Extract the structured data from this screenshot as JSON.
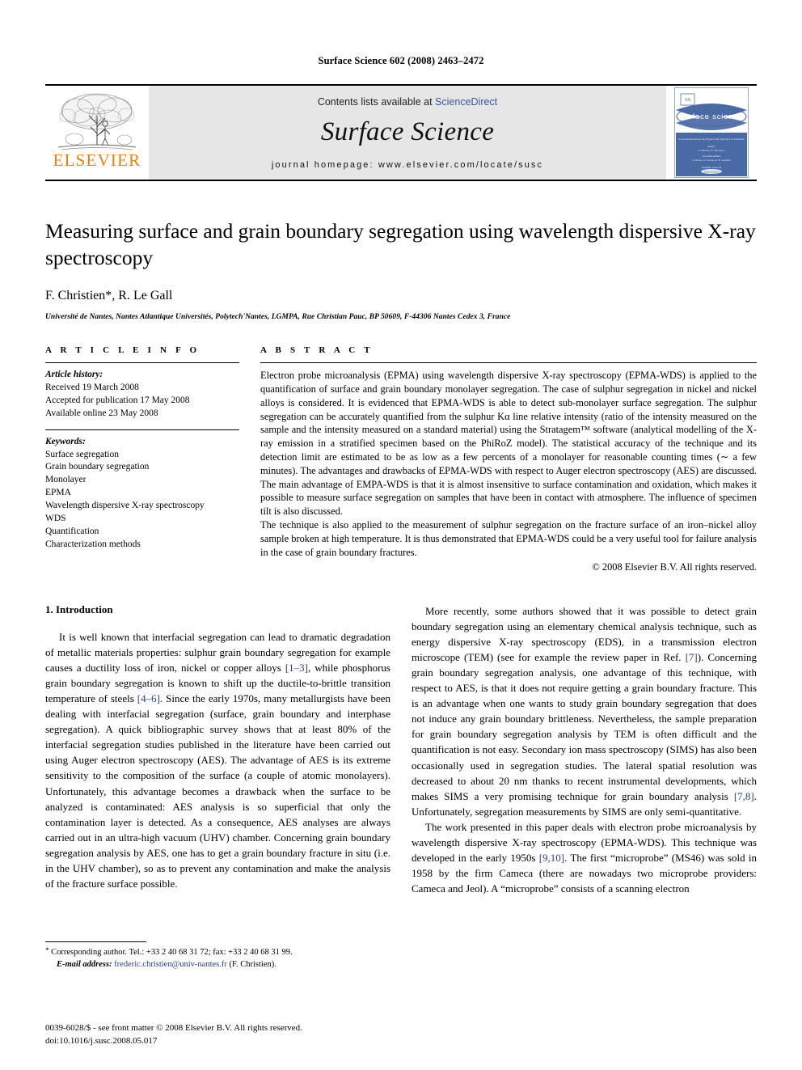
{
  "running_head": "Surface Science 602 (2008) 2463–2472",
  "masthead": {
    "publisher_name": "ELSEVIER",
    "contents_prefix": "Contents lists available at",
    "sciencedirect": "ScienceDirect",
    "journal_title": "Surface Science",
    "homepage": "journal homepage: www.elsevier.com/locate/susc",
    "cover_title": "surface science"
  },
  "article": {
    "title": "Measuring surface and grain boundary segregation using wavelength dispersive X-ray spectroscopy",
    "authors": "F. Christien*, R. Le Gall",
    "affiliation": "Université de Nantes, Nantes Atlantique Universités, Polytech'Nantes, LGMPA, Rue Christian Pauc, BP 50609, F-44306 Nantes Cedex 3, France"
  },
  "article_info": {
    "heading": "A R T I C L E   I N F O",
    "history_label": "Article history:",
    "history": [
      "Received 19 March 2008",
      "Accepted for publication 17 May 2008",
      "Available online 23 May 2008"
    ],
    "keywords_label": "Keywords:",
    "keywords": [
      "Surface segregation",
      "Grain boundary segregation",
      "Monolayer",
      "EPMA",
      "Wavelength dispersive X-ray spectroscopy",
      "WDS",
      "Quantification",
      "Characterization methods"
    ]
  },
  "abstract": {
    "heading": "A B S T R A C T",
    "paragraph1": "Electron probe microanalysis (EPMA) using wavelength dispersive X-ray spectroscopy (EPMA-WDS) is applied to the quantification of surface and grain boundary monolayer segregation. The case of sulphur segregation in nickel and nickel alloys is considered. It is evidenced that EPMA-WDS is able to detect sub-monolayer surface segregation. The sulphur segregation can be accurately quantified from the sulphur Kα line relative intensity (ratio of the intensity measured on the sample and the intensity measured on a standard material) using the Stratagem™ software (analytical modelling of the X-ray emission in a stratified specimen based on the PhiRoZ model). The statistical accuracy of the technique and its detection limit are estimated to be as low as a few percents of a monolayer for reasonable counting times (∼ a few minutes). The advantages and drawbacks of EPMA-WDS with respect to Auger electron spectroscopy (AES) are discussed. The main advantage of EMPA-WDS is that it is almost insensitive to surface contamination and oxidation, which makes it possible to measure surface segregation on samples that have been in contact with atmosphere. The influence of specimen tilt is also discussed.",
    "paragraph2": "The technique is also applied to the measurement of sulphur segregation on the fracture surface of an iron–nickel alloy sample broken at high temperature. It is thus demonstrated that EPMA-WDS could be a very useful tool for failure analysis in the case of grain boundary fractures.",
    "copyright": "© 2008 Elsevier B.V. All rights reserved."
  },
  "introduction": {
    "heading": "1. Introduction",
    "p1_a": "It is well known that interfacial segregation can lead to dramatic degradation of metallic materials properties: sulphur grain boundary segregation for example causes a ductility loss of iron, nickel or copper alloys ",
    "p1_ref1": "[1–3]",
    "p1_b": ", while phosphorus grain boundary segregation is known to shift up the ductile-to-brittle transition temperature of steels ",
    "p1_ref2": "[4–6]",
    "p1_c": ". Since the early 1970s, many metallurgists have been dealing with interfacial segregation (surface, grain boundary and interphase segregation). A quick bibliographic survey shows that at least 80% of the interfacial segregation studies published in the literature have been carried out using Auger electron spectroscopy (AES). The advantage of AES is its extreme sensitivity to the composition of the surface (a couple of atomic monolayers). Unfortunately, this advantage becomes a drawback when the surface to be analyzed is contaminated: AES analysis is so superficial that only the contamination layer is detected. As a consequence, AES analyses are always carried out in an ultra-high vacuum (UHV) chamber. Concerning grain boundary segregation analysis by AES, one has to get a grain boundary fracture in situ (i.e. in the UHV chamber), so as to prevent any contamination and make the analysis of the fracture surface possible.",
    "p2_a": "More recently, some authors showed that it was possible to detect grain boundary segregation using an elementary chemical analysis technique, such as energy dispersive X-ray spectroscopy (EDS), in a transmission electron microscope (TEM) (see for example the review paper in Ref. ",
    "p2_ref1": "[7]",
    "p2_b": "). Concerning grain boundary segregation analysis, one advantage of this technique, with respect to AES, is that it does not require getting a grain boundary fracture. This is an advantage when one wants to study grain boundary segregation that does not induce any grain boundary brittleness. Nevertheless, the sample preparation for grain boundary segregation analysis by TEM is often difficult and the quantification is not easy. Secondary ion mass spectroscopy (SIMS) has also been occasionally used in segregation studies. The lateral spatial resolution was decreased to about 20 nm thanks to recent instrumental developments, which makes SIMS a very promising technique for grain boundary analysis ",
    "p2_ref2": "[7,8]",
    "p2_c": ". Unfortunately, segregation measurements by SIMS are only semi-quantitative.",
    "p3_a": "The work presented in this paper deals with electron probe microanalysis by wavelength dispersive X-ray spectroscopy (EPMA-WDS). This technique was developed in the early 1950s ",
    "p3_ref1": "[9,10]",
    "p3_b": ". The first “microprobe” (MS46) was sold in 1958 by the firm Cameca (there are nowadays two microprobe providers: Cameca and Jeol). A “microprobe” consists of a scanning electron"
  },
  "footnote": {
    "star": "*",
    "corresponding": "Corresponding author. Tel.: +33 2 40 68 31 72; fax: +33 2 40 68 31 99.",
    "email_label": "E-mail address:",
    "email": "frederic.christien@univ-nantes.fr",
    "email_owner": "(F. Christien)."
  },
  "page_footer": {
    "line1": "0039-6028/$ - see front matter © 2008 Elsevier B.V. All rights reserved.",
    "line2": "doi:10.1016/j.susc.2008.05.017"
  },
  "colors": {
    "link": "#3b55a4",
    "reference": "#2b3d8f",
    "elsevier_orange": "#F08000",
    "masthead_bg": "#e6e6e6",
    "cover_blue": "#4a6aa5"
  }
}
